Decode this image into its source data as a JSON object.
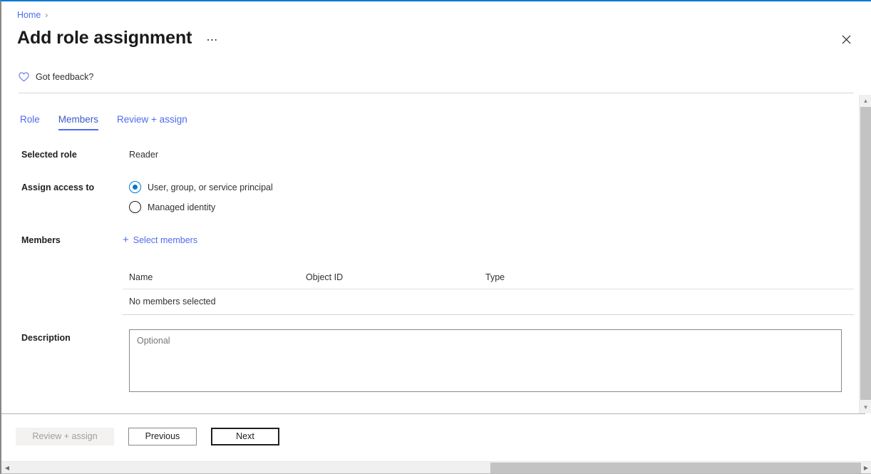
{
  "breadcrumb": {
    "home": "Home",
    "separator": "›"
  },
  "header": {
    "title": "Add role assignment",
    "ellipsis": "⋯",
    "close_label": "Close"
  },
  "feedback": {
    "label": "Got feedback?"
  },
  "tabs": [
    {
      "label": "Role",
      "active": false
    },
    {
      "label": "Members",
      "active": true
    },
    {
      "label": "Review + assign",
      "active": false
    }
  ],
  "form": {
    "selected_role": {
      "label": "Selected role",
      "value": "Reader"
    },
    "assign_access_to": {
      "label": "Assign access to",
      "options": [
        {
          "label": "User, group, or service principal",
          "checked": true
        },
        {
          "label": "Managed identity",
          "checked": false
        }
      ]
    },
    "members": {
      "label": "Members",
      "select_link": "Select members",
      "plus": "+",
      "columns": [
        "Name",
        "Object ID",
        "Type"
      ],
      "empty_text": "No members selected"
    },
    "description": {
      "label": "Description",
      "placeholder": "Optional",
      "value": ""
    }
  },
  "footer": {
    "review_assign": "Review + assign",
    "previous": "Previous",
    "next": "Next"
  },
  "colors": {
    "accent": "#0078d4",
    "link": "#4f6bed",
    "tab_active": "#3b5cc4",
    "text": "#323130",
    "heading": "#201f1e",
    "disabled_text": "#a19f9d"
  }
}
